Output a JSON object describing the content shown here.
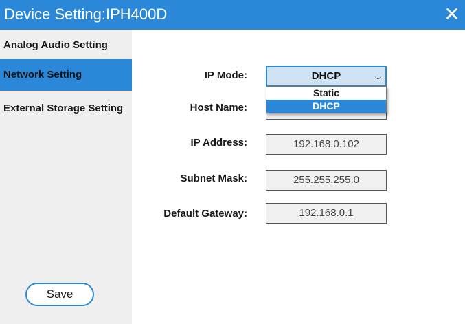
{
  "window": {
    "title": "Device Setting:IPH400D",
    "close_label": "✕"
  },
  "sidebar": {
    "items": [
      {
        "label": "Analog Audio Setting",
        "active": false
      },
      {
        "label": "Network Setting",
        "active": true
      },
      {
        "label": "External Storage Setting",
        "active": false
      }
    ],
    "save_label": "Save"
  },
  "network": {
    "ip_mode": {
      "label": "IP Mode:",
      "value": "DHCP",
      "options": [
        "Static",
        "DHCP"
      ],
      "selected_option": "DHCP"
    },
    "host_name": {
      "label": "Host Name:",
      "value": ""
    },
    "ip_address": {
      "label": "IP Address:",
      "value": "192.168.0.102"
    },
    "subnet_mask": {
      "label": "Subnet Mask:",
      "value": "255.255.255.0"
    },
    "default_gateway": {
      "label": "Default Gateway:",
      "value": "192.168.0.1"
    }
  },
  "colors": {
    "accent": "#2b88d8",
    "sidebar_bg": "#efefef",
    "field_bg": "#f0f0f0"
  }
}
